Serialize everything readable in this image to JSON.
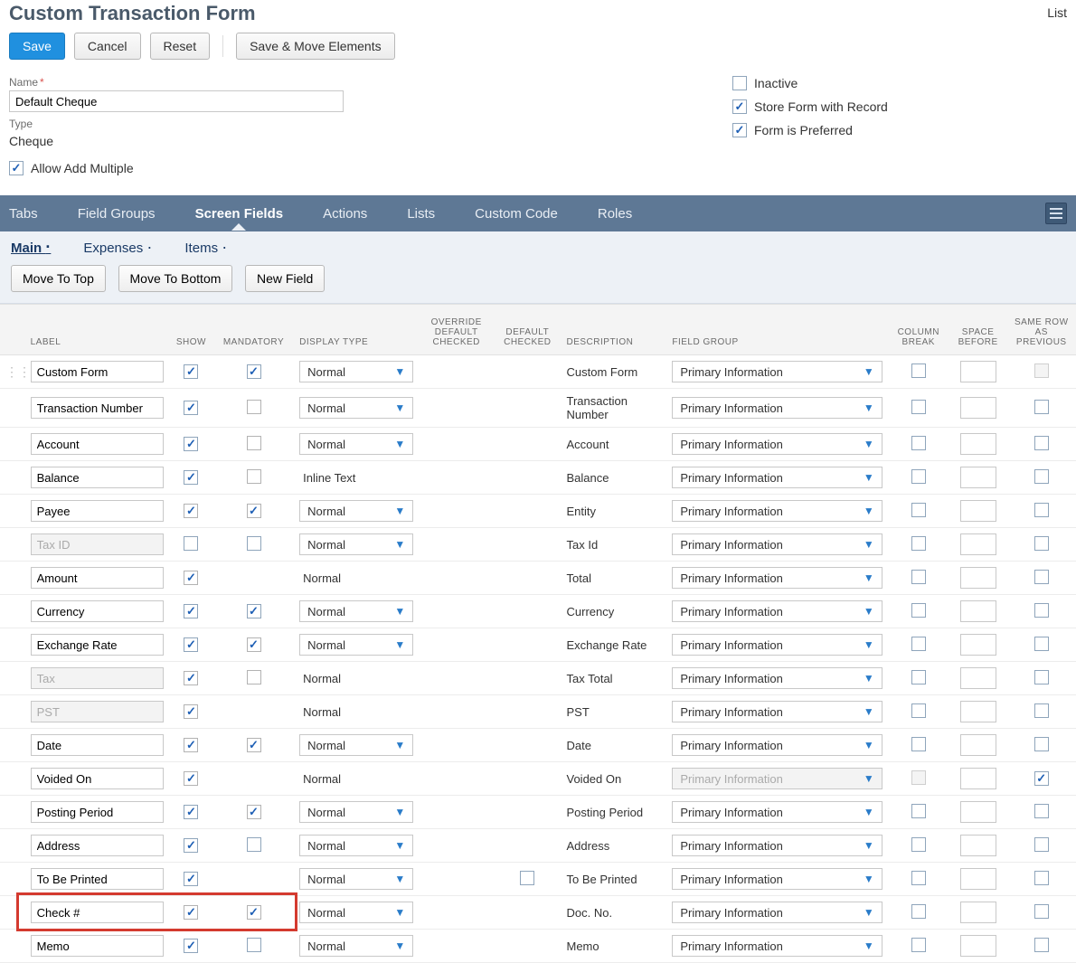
{
  "header": {
    "title": "Custom Transaction Form",
    "list": "List"
  },
  "buttons": {
    "save": "Save",
    "cancel": "Cancel",
    "reset": "Reset",
    "save_move": "Save & Move Elements"
  },
  "form": {
    "name_label": "Name",
    "name_value": "Default Cheque",
    "type_label": "Type",
    "type_value": "Cheque",
    "allow_add_multiple_label": "Allow Add Multiple",
    "allow_add_multiple_checked": true,
    "inactive_label": "Inactive",
    "inactive_checked": false,
    "store_label": "Store Form with Record",
    "store_checked": true,
    "preferred_label": "Form is Preferred",
    "preferred_checked": true
  },
  "tabs": [
    "Tabs",
    "Field Groups",
    "Screen Fields",
    "Actions",
    "Lists",
    "Custom Code",
    "Roles"
  ],
  "active_tab": "Screen Fields",
  "subtabs": [
    "Main",
    "Expenses",
    "Items"
  ],
  "active_subtab": "Main",
  "sub_buttons": {
    "move_top": "Move To Top",
    "move_bottom": "Move To Bottom",
    "new_field": "New Field"
  },
  "columns": {
    "label": "LABEL",
    "show": "SHOW",
    "mandatory": "MANDATORY",
    "display_type": "DISPLAY TYPE",
    "override": "OVERRIDE DEFAULT CHECKED",
    "default": "DEFAULT CHECKED",
    "description": "DESCRIPTION",
    "field_group": "FIELD GROUP",
    "col_break": "COLUMN BREAK",
    "space_before": "SPACE BEFORE",
    "same_row": "SAME ROW AS PREVIOUS"
  },
  "rows": [
    {
      "label": "Custom Form",
      "label_disabled": false,
      "show": true,
      "show_dim": false,
      "mandatory": true,
      "mandatory_dim": false,
      "mandatory_show": true,
      "display_dropdown": true,
      "display": "Normal",
      "override": "",
      "default": "",
      "description": "Custom Form",
      "field_group": "Primary Information",
      "fg_dropdown": true,
      "fg_disabled": false,
      "col_break": false,
      "col_break_show": true,
      "col_break_disabled": false,
      "space": true,
      "same_row": false,
      "same_row_show": true,
      "same_row_disabled": true,
      "drag": true,
      "highlight": false
    },
    {
      "label": "Transaction Number",
      "label_disabled": false,
      "show": true,
      "show_dim": false,
      "mandatory": false,
      "mandatory_dim": true,
      "mandatory_show": true,
      "display_dropdown": true,
      "display": "Normal",
      "override": "",
      "default": "",
      "description": "Transaction Number",
      "field_group": "Primary Information",
      "fg_dropdown": true,
      "fg_disabled": false,
      "col_break": false,
      "col_break_show": true,
      "col_break_disabled": false,
      "space": true,
      "same_row": false,
      "same_row_show": true,
      "same_row_disabled": false,
      "drag": false,
      "highlight": false
    },
    {
      "label": "Account",
      "label_disabled": false,
      "show": true,
      "show_dim": false,
      "mandatory": false,
      "mandatory_dim": true,
      "mandatory_show": true,
      "display_dropdown": true,
      "display": "Normal",
      "override": "",
      "default": "",
      "description": "Account",
      "field_group": "Primary Information",
      "fg_dropdown": true,
      "fg_disabled": false,
      "col_break": false,
      "col_break_show": true,
      "col_break_disabled": false,
      "space": true,
      "same_row": false,
      "same_row_show": true,
      "same_row_disabled": false,
      "drag": false,
      "highlight": false
    },
    {
      "label": "Balance",
      "label_disabled": false,
      "show": true,
      "show_dim": false,
      "mandatory": false,
      "mandatory_dim": true,
      "mandatory_show": true,
      "display_dropdown": false,
      "display": "Inline Text",
      "override": "",
      "default": "",
      "description": "Balance",
      "field_group": "Primary Information",
      "fg_dropdown": true,
      "fg_disabled": false,
      "col_break": false,
      "col_break_show": true,
      "col_break_disabled": false,
      "space": true,
      "same_row": false,
      "same_row_show": true,
      "same_row_disabled": false,
      "drag": false,
      "highlight": false
    },
    {
      "label": "Payee",
      "label_disabled": false,
      "show": true,
      "show_dim": true,
      "mandatory": true,
      "mandatory_dim": true,
      "mandatory_show": true,
      "display_dropdown": true,
      "display": "Normal",
      "override": "",
      "default": "",
      "description": "Entity",
      "field_group": "Primary Information",
      "fg_dropdown": true,
      "fg_disabled": false,
      "col_break": false,
      "col_break_show": true,
      "col_break_disabled": false,
      "space": true,
      "same_row": false,
      "same_row_show": true,
      "same_row_disabled": false,
      "drag": false,
      "highlight": false
    },
    {
      "label": "Tax ID",
      "label_disabled": true,
      "show": false,
      "show_dim": false,
      "mandatory": false,
      "mandatory_dim": false,
      "mandatory_show": true,
      "display_dropdown": true,
      "display": "Normal",
      "override": "",
      "default": "",
      "description": "Tax Id",
      "field_group": "Primary Information",
      "fg_dropdown": true,
      "fg_disabled": false,
      "col_break": false,
      "col_break_show": true,
      "col_break_disabled": false,
      "space": true,
      "same_row": false,
      "same_row_show": true,
      "same_row_disabled": false,
      "drag": false,
      "highlight": false
    },
    {
      "label": "Amount",
      "label_disabled": false,
      "show": true,
      "show_dim": true,
      "mandatory": false,
      "mandatory_dim": false,
      "mandatory_show": false,
      "display_dropdown": false,
      "display": "Normal",
      "override": "",
      "default": "",
      "description": "Total",
      "field_group": "Primary Information",
      "fg_dropdown": true,
      "fg_disabled": false,
      "col_break": false,
      "col_break_show": true,
      "col_break_disabled": false,
      "space": true,
      "same_row": false,
      "same_row_show": true,
      "same_row_disabled": false,
      "drag": false,
      "highlight": false
    },
    {
      "label": "Currency",
      "label_disabled": false,
      "show": true,
      "show_dim": false,
      "mandatory": true,
      "mandatory_dim": false,
      "mandatory_show": true,
      "display_dropdown": true,
      "display": "Normal",
      "override": "",
      "default": "",
      "description": "Currency",
      "field_group": "Primary Information",
      "fg_dropdown": true,
      "fg_disabled": false,
      "col_break": false,
      "col_break_show": true,
      "col_break_disabled": false,
      "space": true,
      "same_row": false,
      "same_row_show": true,
      "same_row_disabled": false,
      "drag": false,
      "highlight": false
    },
    {
      "label": "Exchange Rate",
      "label_disabled": false,
      "show": true,
      "show_dim": false,
      "mandatory": true,
      "mandatory_dim": true,
      "mandatory_show": true,
      "display_dropdown": true,
      "display": "Normal",
      "override": "",
      "default": "",
      "description": "Exchange Rate",
      "field_group": "Primary Information",
      "fg_dropdown": true,
      "fg_disabled": false,
      "col_break": false,
      "col_break_show": true,
      "col_break_disabled": false,
      "space": true,
      "same_row": false,
      "same_row_show": true,
      "same_row_disabled": false,
      "drag": false,
      "highlight": false
    },
    {
      "label": "Tax",
      "label_disabled": true,
      "show": true,
      "show_dim": true,
      "mandatory": false,
      "mandatory_dim": true,
      "mandatory_show": true,
      "display_dropdown": false,
      "display": "Normal",
      "override": "",
      "default": "",
      "description": "Tax Total",
      "field_group": "Primary Information",
      "fg_dropdown": true,
      "fg_disabled": false,
      "col_break": false,
      "col_break_show": true,
      "col_break_disabled": false,
      "space": true,
      "same_row": false,
      "same_row_show": true,
      "same_row_disabled": false,
      "drag": false,
      "highlight": false
    },
    {
      "label": "PST",
      "label_disabled": true,
      "show": true,
      "show_dim": true,
      "mandatory": false,
      "mandatory_dim": false,
      "mandatory_show": false,
      "display_dropdown": false,
      "display": "Normal",
      "override": "",
      "default": "",
      "description": "PST",
      "field_group": "Primary Information",
      "fg_dropdown": true,
      "fg_disabled": false,
      "col_break": false,
      "col_break_show": true,
      "col_break_disabled": false,
      "space": true,
      "same_row": false,
      "same_row_show": true,
      "same_row_disabled": false,
      "drag": false,
      "highlight": false
    },
    {
      "label": "Date",
      "label_disabled": false,
      "show": true,
      "show_dim": true,
      "mandatory": true,
      "mandatory_dim": true,
      "mandatory_show": true,
      "display_dropdown": true,
      "display": "Normal",
      "override": "",
      "default": "",
      "description": "Date",
      "field_group": "Primary Information",
      "fg_dropdown": true,
      "fg_disabled": false,
      "col_break": false,
      "col_break_show": true,
      "col_break_disabled": false,
      "space": true,
      "same_row": false,
      "same_row_show": true,
      "same_row_disabled": false,
      "drag": false,
      "highlight": false
    },
    {
      "label": "Voided On",
      "label_disabled": false,
      "show": true,
      "show_dim": true,
      "mandatory": false,
      "mandatory_dim": false,
      "mandatory_show": false,
      "display_dropdown": false,
      "display": "Normal",
      "override": "",
      "default": "",
      "description": "Voided On",
      "field_group": "Primary Information",
      "fg_dropdown": true,
      "fg_disabled": true,
      "col_break": false,
      "col_break_show": true,
      "col_break_disabled": true,
      "space": true,
      "same_row": true,
      "same_row_show": true,
      "same_row_disabled": false,
      "drag": false,
      "highlight": false
    },
    {
      "label": "Posting Period",
      "label_disabled": false,
      "show": true,
      "show_dim": false,
      "mandatory": true,
      "mandatory_dim": true,
      "mandatory_show": true,
      "display_dropdown": true,
      "display": "Normal",
      "override": "",
      "default": "",
      "description": "Posting Period",
      "field_group": "Primary Information",
      "fg_dropdown": true,
      "fg_disabled": false,
      "col_break": false,
      "col_break_show": true,
      "col_break_disabled": false,
      "space": true,
      "same_row": false,
      "same_row_show": true,
      "same_row_disabled": false,
      "drag": false,
      "highlight": false
    },
    {
      "label": "Address",
      "label_disabled": false,
      "show": true,
      "show_dim": false,
      "mandatory": false,
      "mandatory_dim": false,
      "mandatory_show": true,
      "display_dropdown": true,
      "display": "Normal",
      "override": "",
      "default": "",
      "description": "Address",
      "field_group": "Primary Information",
      "fg_dropdown": true,
      "fg_disabled": false,
      "col_break": false,
      "col_break_show": true,
      "col_break_disabled": false,
      "space": true,
      "same_row": false,
      "same_row_show": true,
      "same_row_disabled": false,
      "drag": false,
      "highlight": false
    },
    {
      "label": "To Be Printed",
      "label_disabled": false,
      "show": true,
      "show_dim": false,
      "mandatory": false,
      "mandatory_dim": false,
      "mandatory_show": false,
      "display_dropdown": true,
      "display": "Normal",
      "override": "",
      "default": "box",
      "description": "To Be Printed",
      "field_group": "Primary Information",
      "fg_dropdown": true,
      "fg_disabled": false,
      "col_break": false,
      "col_break_show": true,
      "col_break_disabled": false,
      "space": true,
      "same_row": false,
      "same_row_show": true,
      "same_row_disabled": false,
      "drag": false,
      "highlight": false
    },
    {
      "label": "Check #",
      "label_disabled": false,
      "show": true,
      "show_dim": true,
      "mandatory": true,
      "mandatory_dim": true,
      "mandatory_show": true,
      "display_dropdown": true,
      "display": "Normal",
      "override": "",
      "default": "",
      "description": "Doc. No.",
      "field_group": "Primary Information",
      "fg_dropdown": true,
      "fg_disabled": false,
      "col_break": false,
      "col_break_show": true,
      "col_break_disabled": false,
      "space": true,
      "same_row": false,
      "same_row_show": true,
      "same_row_disabled": false,
      "drag": false,
      "highlight": true
    },
    {
      "label": "Memo",
      "label_disabled": false,
      "show": true,
      "show_dim": false,
      "mandatory": false,
      "mandatory_dim": false,
      "mandatory_show": true,
      "display_dropdown": true,
      "display": "Normal",
      "override": "",
      "default": "",
      "description": "Memo",
      "field_group": "Primary Information",
      "fg_dropdown": true,
      "fg_disabled": false,
      "col_break": false,
      "col_break_show": true,
      "col_break_disabled": false,
      "space": true,
      "same_row": false,
      "same_row_show": true,
      "same_row_disabled": false,
      "drag": false,
      "highlight": false
    }
  ]
}
